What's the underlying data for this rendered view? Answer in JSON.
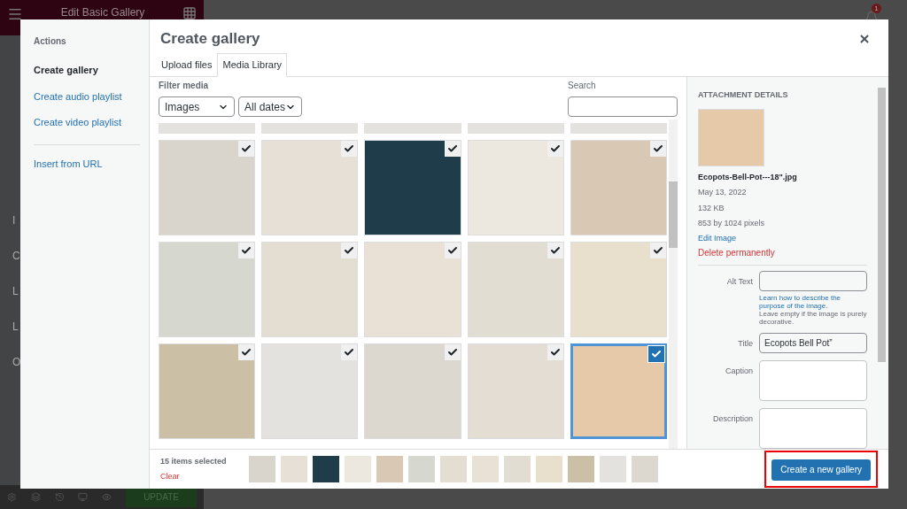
{
  "editor": {
    "title": "Edit Basic Gallery",
    "notification_count": "1",
    "side_letters": [
      "I",
      "C",
      "L",
      "L",
      "O"
    ],
    "update_button": "UPDATE"
  },
  "modal": {
    "sidebar": {
      "heading": "Actions",
      "items": [
        {
          "label": "Create gallery",
          "selected": true
        },
        {
          "label": "Create audio playlist",
          "selected": false
        },
        {
          "label": "Create video playlist",
          "selected": false
        },
        {
          "label": "Insert from URL",
          "selected": false
        }
      ]
    },
    "title": "Create gallery",
    "tabs": [
      {
        "label": "Upload files",
        "selected": false
      },
      {
        "label": "Media Library",
        "selected": true
      }
    ],
    "filter": {
      "label": "Filter media",
      "type_select": "Images",
      "date_select": "All dates"
    },
    "search": {
      "label": "Search"
    },
    "grid": [
      {
        "checked": true,
        "selected": false
      },
      {
        "checked": true,
        "selected": false
      },
      {
        "checked": true,
        "selected": false
      },
      {
        "checked": true,
        "selected": false
      },
      {
        "checked": true,
        "selected": false
      },
      {
        "checked": true,
        "selected": false
      },
      {
        "checked": true,
        "selected": false
      },
      {
        "checked": true,
        "selected": false
      },
      {
        "checked": true,
        "selected": false
      },
      {
        "checked": true,
        "selected": false
      },
      {
        "checked": true,
        "selected": false
      },
      {
        "checked": true,
        "selected": false
      },
      {
        "checked": true,
        "selected": false
      },
      {
        "checked": true,
        "selected": false
      },
      {
        "checked": true,
        "selected": true
      }
    ],
    "details": {
      "heading": "ATTACHMENT DETAILS",
      "filename": "Ecopots-Bell-Pot---18\".jpg",
      "date": "May 13, 2022",
      "size": "132 KB",
      "dimensions": "853 by 1024 pixels",
      "edit_link": "Edit Image",
      "delete_link": "Delete permanently",
      "fields": [
        {
          "kind": "input",
          "label": "Alt Text"
        },
        {
          "kind": "input",
          "label": "Title",
          "value": "Ecopots Bell Pot”"
        },
        {
          "kind": "textarea",
          "label": "Caption"
        },
        {
          "kind": "textarea",
          "label": "Description"
        }
      ],
      "alt_help_link": "Learn how to describe the purpose of the image.",
      "alt_help_text": "Leave empty if the image is purely decorative."
    },
    "footer": {
      "count": "15 items selected",
      "clear": "Clear",
      "button": "Create a new gallery"
    }
  }
}
